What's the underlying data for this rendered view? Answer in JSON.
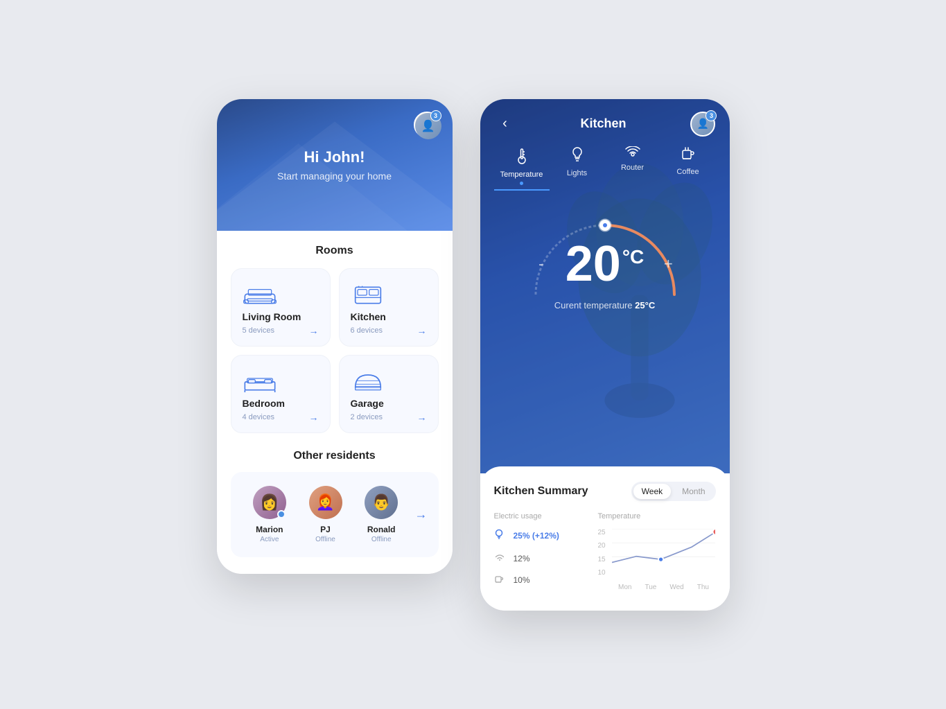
{
  "app": {
    "bg_color": "#e8eaef"
  },
  "left_phone": {
    "header": {
      "greeting": "Hi John!",
      "subtitle": "Start managing your home",
      "avatar_badge": "3"
    },
    "rooms_section": {
      "title": "Rooms",
      "rooms": [
        {
          "name": "Living Room",
          "devices": "5 devices",
          "icon": "sofa"
        },
        {
          "name": "Kitchen",
          "devices": "6 devices",
          "icon": "oven"
        },
        {
          "name": "Bedroom",
          "devices": "4 devices",
          "icon": "bed"
        },
        {
          "name": "Garage",
          "devices": "2 devices",
          "icon": "garage"
        }
      ]
    },
    "residents_section": {
      "title": "Other residents",
      "residents": [
        {
          "name": "Marion",
          "status": "Active",
          "online": true,
          "emoji": "👩"
        },
        {
          "name": "PJ",
          "status": "Offline",
          "online": false,
          "emoji": "👩‍🦰"
        },
        {
          "name": "Ronald",
          "status": "Offline",
          "online": false,
          "emoji": "👨"
        }
      ]
    }
  },
  "right_phone": {
    "header": {
      "title": "Kitchen",
      "back_label": "‹",
      "avatar_badge": "3"
    },
    "device_tabs": [
      {
        "label": "Temperature",
        "icon": "🌡",
        "active": true
      },
      {
        "label": "Lights",
        "icon": "💡",
        "active": false
      },
      {
        "label": "Router",
        "icon": "📶",
        "active": false
      },
      {
        "label": "Coffee",
        "icon": "☕",
        "active": false
      }
    ],
    "thermostat": {
      "value": "20",
      "unit": "°C",
      "minus_label": "-",
      "plus_label": "+",
      "current_label": "Curent temperature",
      "current_value": "25°C"
    },
    "summary": {
      "title": "Kitchen Summary",
      "toggle_week": "Week",
      "toggle_month": "Month",
      "active_toggle": "week",
      "electric_usage_label": "Electric usage",
      "temperature_label": "Temperature",
      "usage_items": [
        {
          "icon": "bulb",
          "value": "25% (+12%)",
          "highlight": true
        },
        {
          "icon": "wifi",
          "value": "12%",
          "highlight": false
        },
        {
          "icon": "coffee",
          "value": "10%",
          "highlight": false
        }
      ],
      "chart": {
        "y_labels": [
          "25",
          "20",
          "15",
          "10"
        ],
        "x_labels": [
          "Mon",
          "Tue",
          "Wed",
          "Thu"
        ],
        "line_points": "10,60 40,45 80,50 120,35 160,10"
      }
    }
  }
}
